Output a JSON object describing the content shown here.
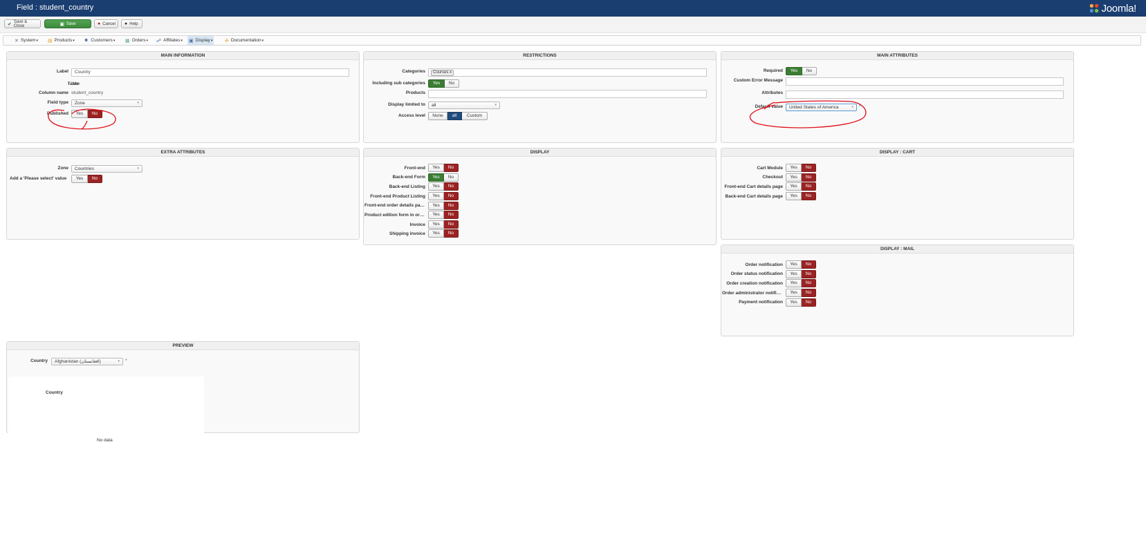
{
  "window": {
    "title": "Field : student_country",
    "logo_text": "Joomla!"
  },
  "toolbar": {
    "save_close": "Save & Close",
    "save": "Save",
    "cancel": "Cancel",
    "help": "Help"
  },
  "menu": {
    "system": "System",
    "products": "Products",
    "customers": "Customers",
    "orders": "Orders",
    "affiliates": "Affiliates",
    "display": "Display",
    "documentation": "Documentation"
  },
  "main_info": {
    "title": "MAIN INFORMATION",
    "label_label": "Label",
    "label_value": "Country",
    "table_label": "Table",
    "table_value": "item",
    "column_label": "Column name",
    "column_value": "student_country",
    "fieldtype_label": "Field type",
    "fieldtype_value": "Zone",
    "published_label": "Published",
    "published": "No"
  },
  "restrictions": {
    "title": "RESTRICTIONS",
    "categories_label": "Categories",
    "categories_tag": "Courses",
    "subcat_label": "Including sub categories",
    "subcat": "Yes",
    "products_label": "Products",
    "limited_label": "Display limited to",
    "limited_value": "all",
    "access_label": "Access level",
    "access_none": "None",
    "access_all": "all",
    "access_custom": "Custom",
    "access": "all"
  },
  "main_attributes": {
    "title": "MAIN ATTRIBUTES",
    "required_label": "Required",
    "required": "Yes",
    "error_label": "Custom Error Message",
    "attributes_label": "Attributes",
    "default_label": "Default value",
    "default_value": "United States of America"
  },
  "extra_attributes": {
    "title": "EXTRA ATTRIBUTES",
    "zone_label": "Zone",
    "zone_value": "Countries",
    "please_select_label": "Add a 'Please select' value",
    "please_select": "No"
  },
  "display": {
    "title": "DISPLAY",
    "items": [
      {
        "label": "Front-end",
        "value": "No"
      },
      {
        "label": "Back-end Form",
        "value": "Yes"
      },
      {
        "label": "Back-end Listing",
        "value": "No"
      },
      {
        "label": "Front-end Product Listing",
        "value": "No"
      },
      {
        "label": "Front-end order details page",
        "value": "No"
      },
      {
        "label": "Product edition form in orders",
        "value": "No"
      },
      {
        "label": "Invoice",
        "value": "No"
      },
      {
        "label": "Shipping invoice",
        "value": "No"
      }
    ]
  },
  "display_cart": {
    "title": "DISPLAY : CART",
    "items": [
      {
        "label": "Cart Module",
        "value": "No"
      },
      {
        "label": "Checkout",
        "value": "No"
      },
      {
        "label": "Front-end Cart details page",
        "value": "No"
      },
      {
        "label": "Back-end Cart details page",
        "value": "No"
      }
    ]
  },
  "display_mail": {
    "title": "DISPLAY : MAIL",
    "items": [
      {
        "label": "Order notification",
        "value": "No"
      },
      {
        "label": "Order status notification",
        "value": "No"
      },
      {
        "label": "Order creation notification",
        "value": "No"
      },
      {
        "label": "Order administrator notification",
        "value": "No"
      },
      {
        "label": "Payment notification",
        "value": "No"
      }
    ]
  },
  "preview": {
    "title": "PREVIEW",
    "country_label": "Country",
    "country_value": "Afghanistan (افغانستان)",
    "required_mark": "*",
    "column_header": "Country",
    "no_data": "No data"
  },
  "common": {
    "yes": "Yes",
    "no": "No"
  },
  "colors": {
    "topbar": "#1b3e71",
    "yes_active": "#3b7d33",
    "no_active": "#9b2323",
    "annotation": "#e0101a"
  }
}
